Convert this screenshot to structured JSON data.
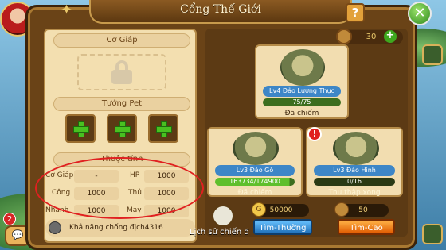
{
  "window": {
    "title": "Cổng Thế Giới",
    "help_label": "?",
    "close_label": "✕"
  },
  "side": {
    "notification_count": "2"
  },
  "left_panel": {
    "armor_label": "Cơ Giáp",
    "pet_label": "Tướng Pet",
    "attributes_label": "Thuộc tính",
    "stats": [
      {
        "label": "Cơ Giáp",
        "value": "-"
      },
      {
        "label": "HP",
        "value": "1000"
      },
      {
        "label": "Công",
        "value": "1000"
      },
      {
        "label": "Thủ",
        "value": "1000"
      },
      {
        "label": "Nhanh",
        "value": "1000"
      },
      {
        "label": "May",
        "value": "1000"
      }
    ],
    "ability_text": "Khả năng chống địch4316"
  },
  "resources": {
    "top_count": "30",
    "gold": "50000",
    "food": "50"
  },
  "islands": [
    {
      "name": "Lv4 Đảo Lương Thực",
      "progress": "75/75",
      "progress_fraction": 1.0,
      "status": "Đã chiếm"
    },
    {
      "name": "Lv3 Đảo Gỗ",
      "progress": "163734/174900",
      "progress_fraction": 0.936,
      "status": "Đã chiếm"
    },
    {
      "name": "Lv3 Đảo Hình",
      "progress": "0/16",
      "progress_fraction": 0.0,
      "status": "Thu thập xong"
    }
  ],
  "bottom": {
    "history_label": "Lịch sử chiến đ",
    "search_normal": "Tìm-Thường",
    "search_advanced": "Tìm-Cao"
  },
  "colors": {
    "frame": "#6a4317",
    "accent_green": "#49c021",
    "highlight_circle": "#e02020"
  }
}
